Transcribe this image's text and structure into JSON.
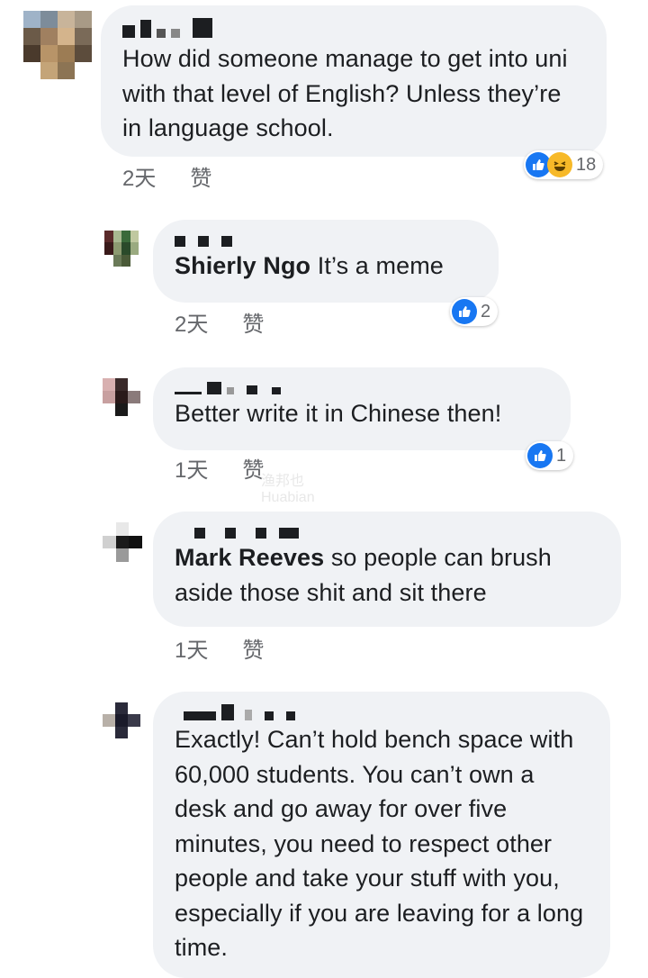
{
  "comments": [
    {
      "author": "",
      "text": "How did someone manage to get into uni with that level of English? Unless they’re in language school.",
      "time": "2天",
      "like_label": "赞",
      "reaction_count": "18",
      "reactions": [
        "like-icon",
        "haha-icon"
      ]
    },
    {
      "author": "Shierly Ngo",
      "text": "It’s a meme",
      "time": "2天",
      "like_label": "赞",
      "reaction_count": "2",
      "reactions": [
        "like-icon"
      ]
    },
    {
      "author": "",
      "text": "Better write it in Chinese then!",
      "time": "1天",
      "like_label": "赞",
      "reaction_count": "1",
      "reactions": [
        "like-icon"
      ]
    },
    {
      "author": "Mark Reeves",
      "text": "so people can brush aside those shit and sit there",
      "time": "1天",
      "like_label": "赞",
      "reaction_count": "",
      "reactions": []
    },
    {
      "author": "",
      "text": "Exactly! Can’t hold bench space with 60,000 students. You can’t own a desk and go away for over five minutes, you need to respect other people and take your stuff with you, especially if you are leaving for a long time.",
      "time": "",
      "like_label": "",
      "reaction_count": "",
      "reactions": []
    }
  ],
  "colors": {
    "bubble": "#f0f2f5",
    "like_blue": "#1877f2",
    "haha_yellow": "#f7b928",
    "meta_gray": "#65676b"
  },
  "watermark": {
    "line1": "渔邦也",
    "line2": "Huabian"
  }
}
